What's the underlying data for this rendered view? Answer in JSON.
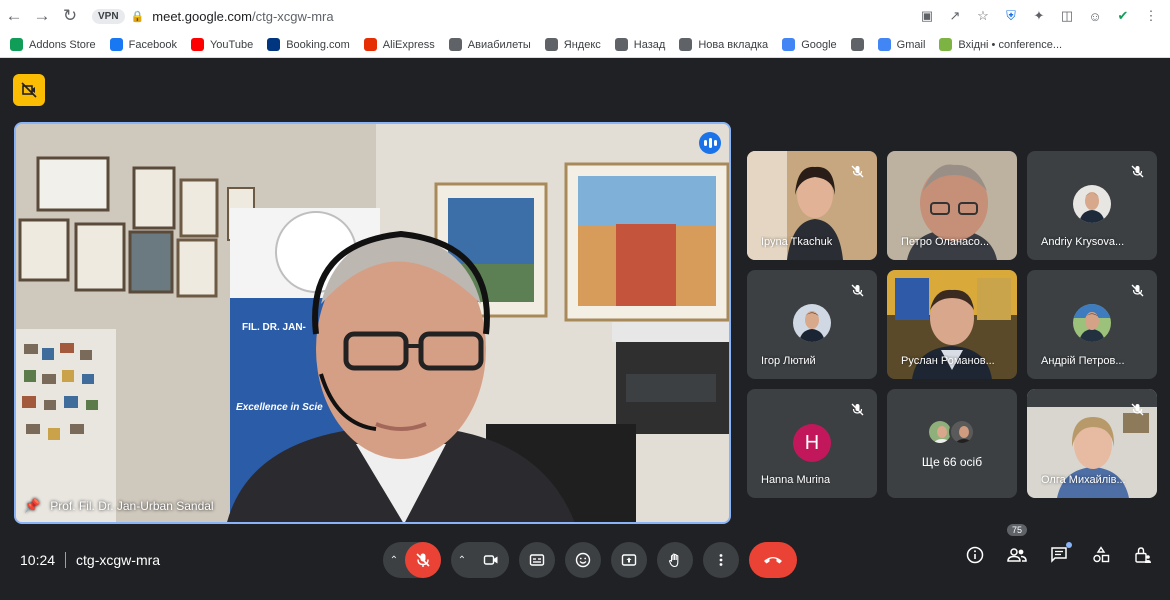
{
  "browser": {
    "vpn_label": "VPN",
    "url_host": "meet.google.com",
    "url_path": "/ctg-xcgw-mra"
  },
  "bookmarks": [
    {
      "label": "Addons Store",
      "color": "#0f9d58"
    },
    {
      "label": "Facebook",
      "color": "#1877f2"
    },
    {
      "label": "YouTube",
      "color": "#ff0000"
    },
    {
      "label": "Booking.com",
      "color": "#003580"
    },
    {
      "label": "AliExpress",
      "color": "#e62e04"
    },
    {
      "label": "Авиабилеты",
      "color": "#5f6368"
    },
    {
      "label": "Яндекс",
      "color": "#5f6368"
    },
    {
      "label": "Назад",
      "color": "#5f6368"
    },
    {
      "label": "Нова вкладка",
      "color": "#5f6368"
    },
    {
      "label": "Google",
      "color": "#4285f4"
    },
    {
      "label": "",
      "color": "#5f6368"
    },
    {
      "label": "Gmail",
      "color": "#4285f4"
    },
    {
      "label": "Вхідні • conference...",
      "color": "#7cb342"
    }
  ],
  "main": {
    "speaker_name": "Prof. Fil. Dr. Jan-Urban Sandal",
    "banner_line1": "FIL. DR. JAN-",
    "banner_line2": "Excellence in Scie"
  },
  "participants": [
    {
      "name": "Іруna Tkachuk",
      "muted": true
    },
    {
      "name": "Петро Оланасо...",
      "muted": false
    },
    {
      "name": "Andriy Krysova...",
      "muted": true
    },
    {
      "name": "Ігор Лютий",
      "muted": true
    },
    {
      "name": "Руслан Романов...",
      "muted": false
    },
    {
      "name": "Андрій Петров...",
      "muted": true
    },
    {
      "name": "Hanna Murina",
      "muted": true,
      "initial": "H"
    },
    {
      "name": "Олга Михайлів...",
      "muted": true
    }
  ],
  "others_label": "Ще 66 осіб",
  "meeting": {
    "time": "10:24",
    "code": "ctg-xcgw-mra",
    "participant_count": "75"
  },
  "colors": {
    "accent": "#8ab4f8",
    "hangup": "#ea4335",
    "host_badge": "#fbbc04"
  }
}
